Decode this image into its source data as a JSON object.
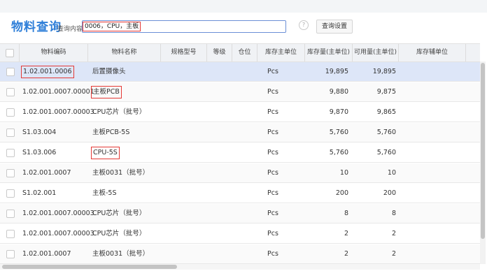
{
  "header": {
    "title": "物料查询",
    "search_label": "查询内容",
    "search_value": "0006，CPU，主板",
    "help_icon": "?",
    "settings_label": "查询设置"
  },
  "columns": {
    "code": "物料编码",
    "name": "物料名称",
    "spec": "规格型号",
    "grade": "等级",
    "location": "仓位",
    "unit": "库存主单位",
    "stock_qty": "库存量(主单位)",
    "avail_qty": "可用量(主单位)",
    "aux_unit": "库存辅单位"
  },
  "rows": [
    {
      "code": "1.02.001.0006",
      "name": "后置摄像头",
      "unit": "Pcs",
      "stock_qty": "19,895",
      "avail_qty": "19,895"
    },
    {
      "code": "1.02.001.0007.00001",
      "name": "主板PCB",
      "unit": "Pcs",
      "stock_qty": "9,880",
      "avail_qty": "9,875"
    },
    {
      "code": "1.02.001.0007.00003",
      "name": "CPU芯片（批号）",
      "unit": "Pcs",
      "stock_qty": "9,870",
      "avail_qty": "9,865"
    },
    {
      "code": "S1.03.004",
      "name": "主板PCB-5S",
      "unit": "Pcs",
      "stock_qty": "5,760",
      "avail_qty": "5,760"
    },
    {
      "code": "S1.03.006",
      "name": "CPU-5S",
      "unit": "Pcs",
      "stock_qty": "5,760",
      "avail_qty": "5,760"
    },
    {
      "code": "1.02.001.0007",
      "name": "主板0031（批号）",
      "unit": "Pcs",
      "stock_qty": "10",
      "avail_qty": "10"
    },
    {
      "code": "S1.02.001",
      "name": "主板-5S",
      "unit": "Pcs",
      "stock_qty": "200",
      "avail_qty": "200"
    },
    {
      "code": "1.02.001.0007.00003",
      "name": "CPU芯片（批号）",
      "unit": "Pcs",
      "stock_qty": "8",
      "avail_qty": "8"
    },
    {
      "code": "1.02.001.0007.00003",
      "name": "CPU芯片（批号）",
      "unit": "Pcs",
      "stock_qty": "2",
      "avail_qty": "2"
    },
    {
      "code": "1.02.001.0007",
      "name": "主板0031（批号）",
      "unit": "Pcs",
      "stock_qty": "2",
      "avail_qty": "2"
    }
  ],
  "colors": {
    "accent": "#2f7fd8",
    "highlight_border": "#e53935",
    "selected_row": "#dde6f8"
  }
}
